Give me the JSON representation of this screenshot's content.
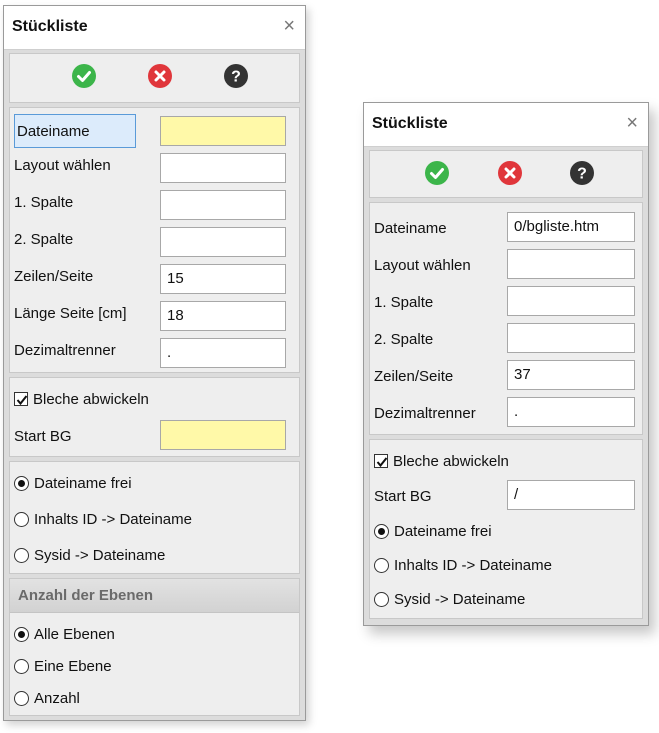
{
  "left_dialog": {
    "title": "Stückliste",
    "close_glyph": "×",
    "toolbar": {
      "ok_icon": "check-circle-icon",
      "cancel_icon": "x-circle-icon",
      "help_icon": "help-circle-icon",
      "colors": {
        "ok": "#3cb54a",
        "cancel": "#e0363b",
        "help": "#333333"
      }
    },
    "fields": [
      {
        "label": "Dateiname",
        "value": "",
        "highlight": true,
        "selected": true
      },
      {
        "label": "Layout wählen",
        "value": ""
      },
      {
        "label": "1. Spalte",
        "value": ""
      },
      {
        "label": "2. Spalte",
        "value": ""
      },
      {
        "label": "Zeilen/Seite",
        "value": "15"
      },
      {
        "label": "Länge Seite [cm]",
        "value": "18"
      },
      {
        "label": "Dezimaltrenner",
        "value": "."
      }
    ],
    "bleche": {
      "label": "Bleche abwickeln",
      "checked": true
    },
    "start_bg": {
      "label": "Start BG",
      "value": ""
    },
    "filename_options": [
      {
        "label": "Dateiname frei",
        "checked": true
      },
      {
        "label": "Inhalts ID -> Dateiname",
        "checked": false
      },
      {
        "label": "Sysid -> Dateiname",
        "checked": false
      }
    ],
    "levels": {
      "header": "Anzahl der Ebenen",
      "options": [
        {
          "label": "Alle Ebenen",
          "checked": true
        },
        {
          "label": "Eine Ebene",
          "checked": false
        },
        {
          "label": "Anzahl",
          "checked": false
        }
      ],
      "count_value": ""
    }
  },
  "right_dialog": {
    "title": "Stückliste",
    "close_glyph": "×",
    "fields": [
      {
        "label": "Dateiname",
        "value": "0/bgliste.htm"
      },
      {
        "label": "Layout wählen",
        "value": ""
      },
      {
        "label": "1. Spalte",
        "value": ""
      },
      {
        "label": "2. Spalte",
        "value": ""
      },
      {
        "label": "Zeilen/Seite",
        "value": "37"
      },
      {
        "label": "Dezimaltrenner",
        "value": "."
      }
    ],
    "bleche": {
      "label": "Bleche abwickeln",
      "checked": true
    },
    "start_bg": {
      "label": "Start BG",
      "value": "/"
    },
    "filename_options": [
      {
        "label": "Dateiname frei",
        "checked": true
      },
      {
        "label": "Inhalts ID -> Dateiname",
        "checked": false
      },
      {
        "label": "Sysid -> Dateiname",
        "checked": false
      }
    ]
  }
}
